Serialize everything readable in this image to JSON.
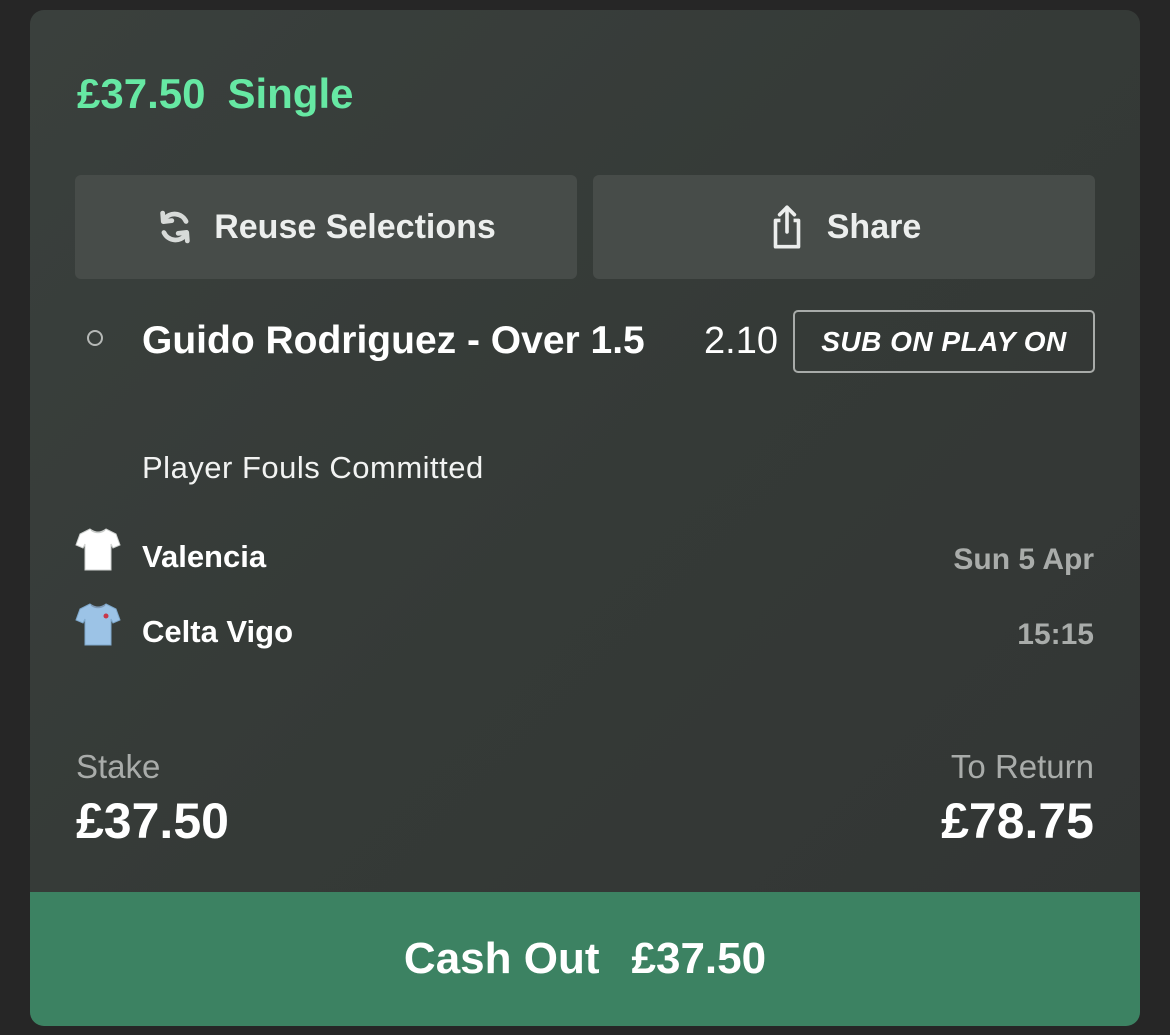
{
  "bet": {
    "header_amount": "£37.50",
    "bet_type": "Single"
  },
  "actions": {
    "reuse_label": "Reuse Selections",
    "reuse_icon": "refresh-icon",
    "share_label": "Share",
    "share_icon": "share-icon"
  },
  "selection": {
    "name": "Guido Rodriguez - Over 1.5",
    "odds": "2.10",
    "badge": "SUB ON PLAY ON",
    "market": "Player Fouls Committed"
  },
  "event": {
    "teams": [
      {
        "name": "Valencia",
        "icon": "white-shirt-icon",
        "color": "#ffffff"
      },
      {
        "name": "Celta Vigo",
        "icon": "light-blue-shirt-icon",
        "color": "#9cc3e6"
      }
    ],
    "date": "Sun 5 Apr",
    "time": "15:15"
  },
  "summary": {
    "stake_label": "Stake",
    "stake_value": "£37.50",
    "return_label": "To Return",
    "return_value": "£78.75"
  },
  "cashout": {
    "label": "Cash Out",
    "amount": "£37.50"
  },
  "colors": {
    "accent_green": "#66e8a3",
    "cashout_green": "#3c8262",
    "card_background": "#373c39"
  }
}
